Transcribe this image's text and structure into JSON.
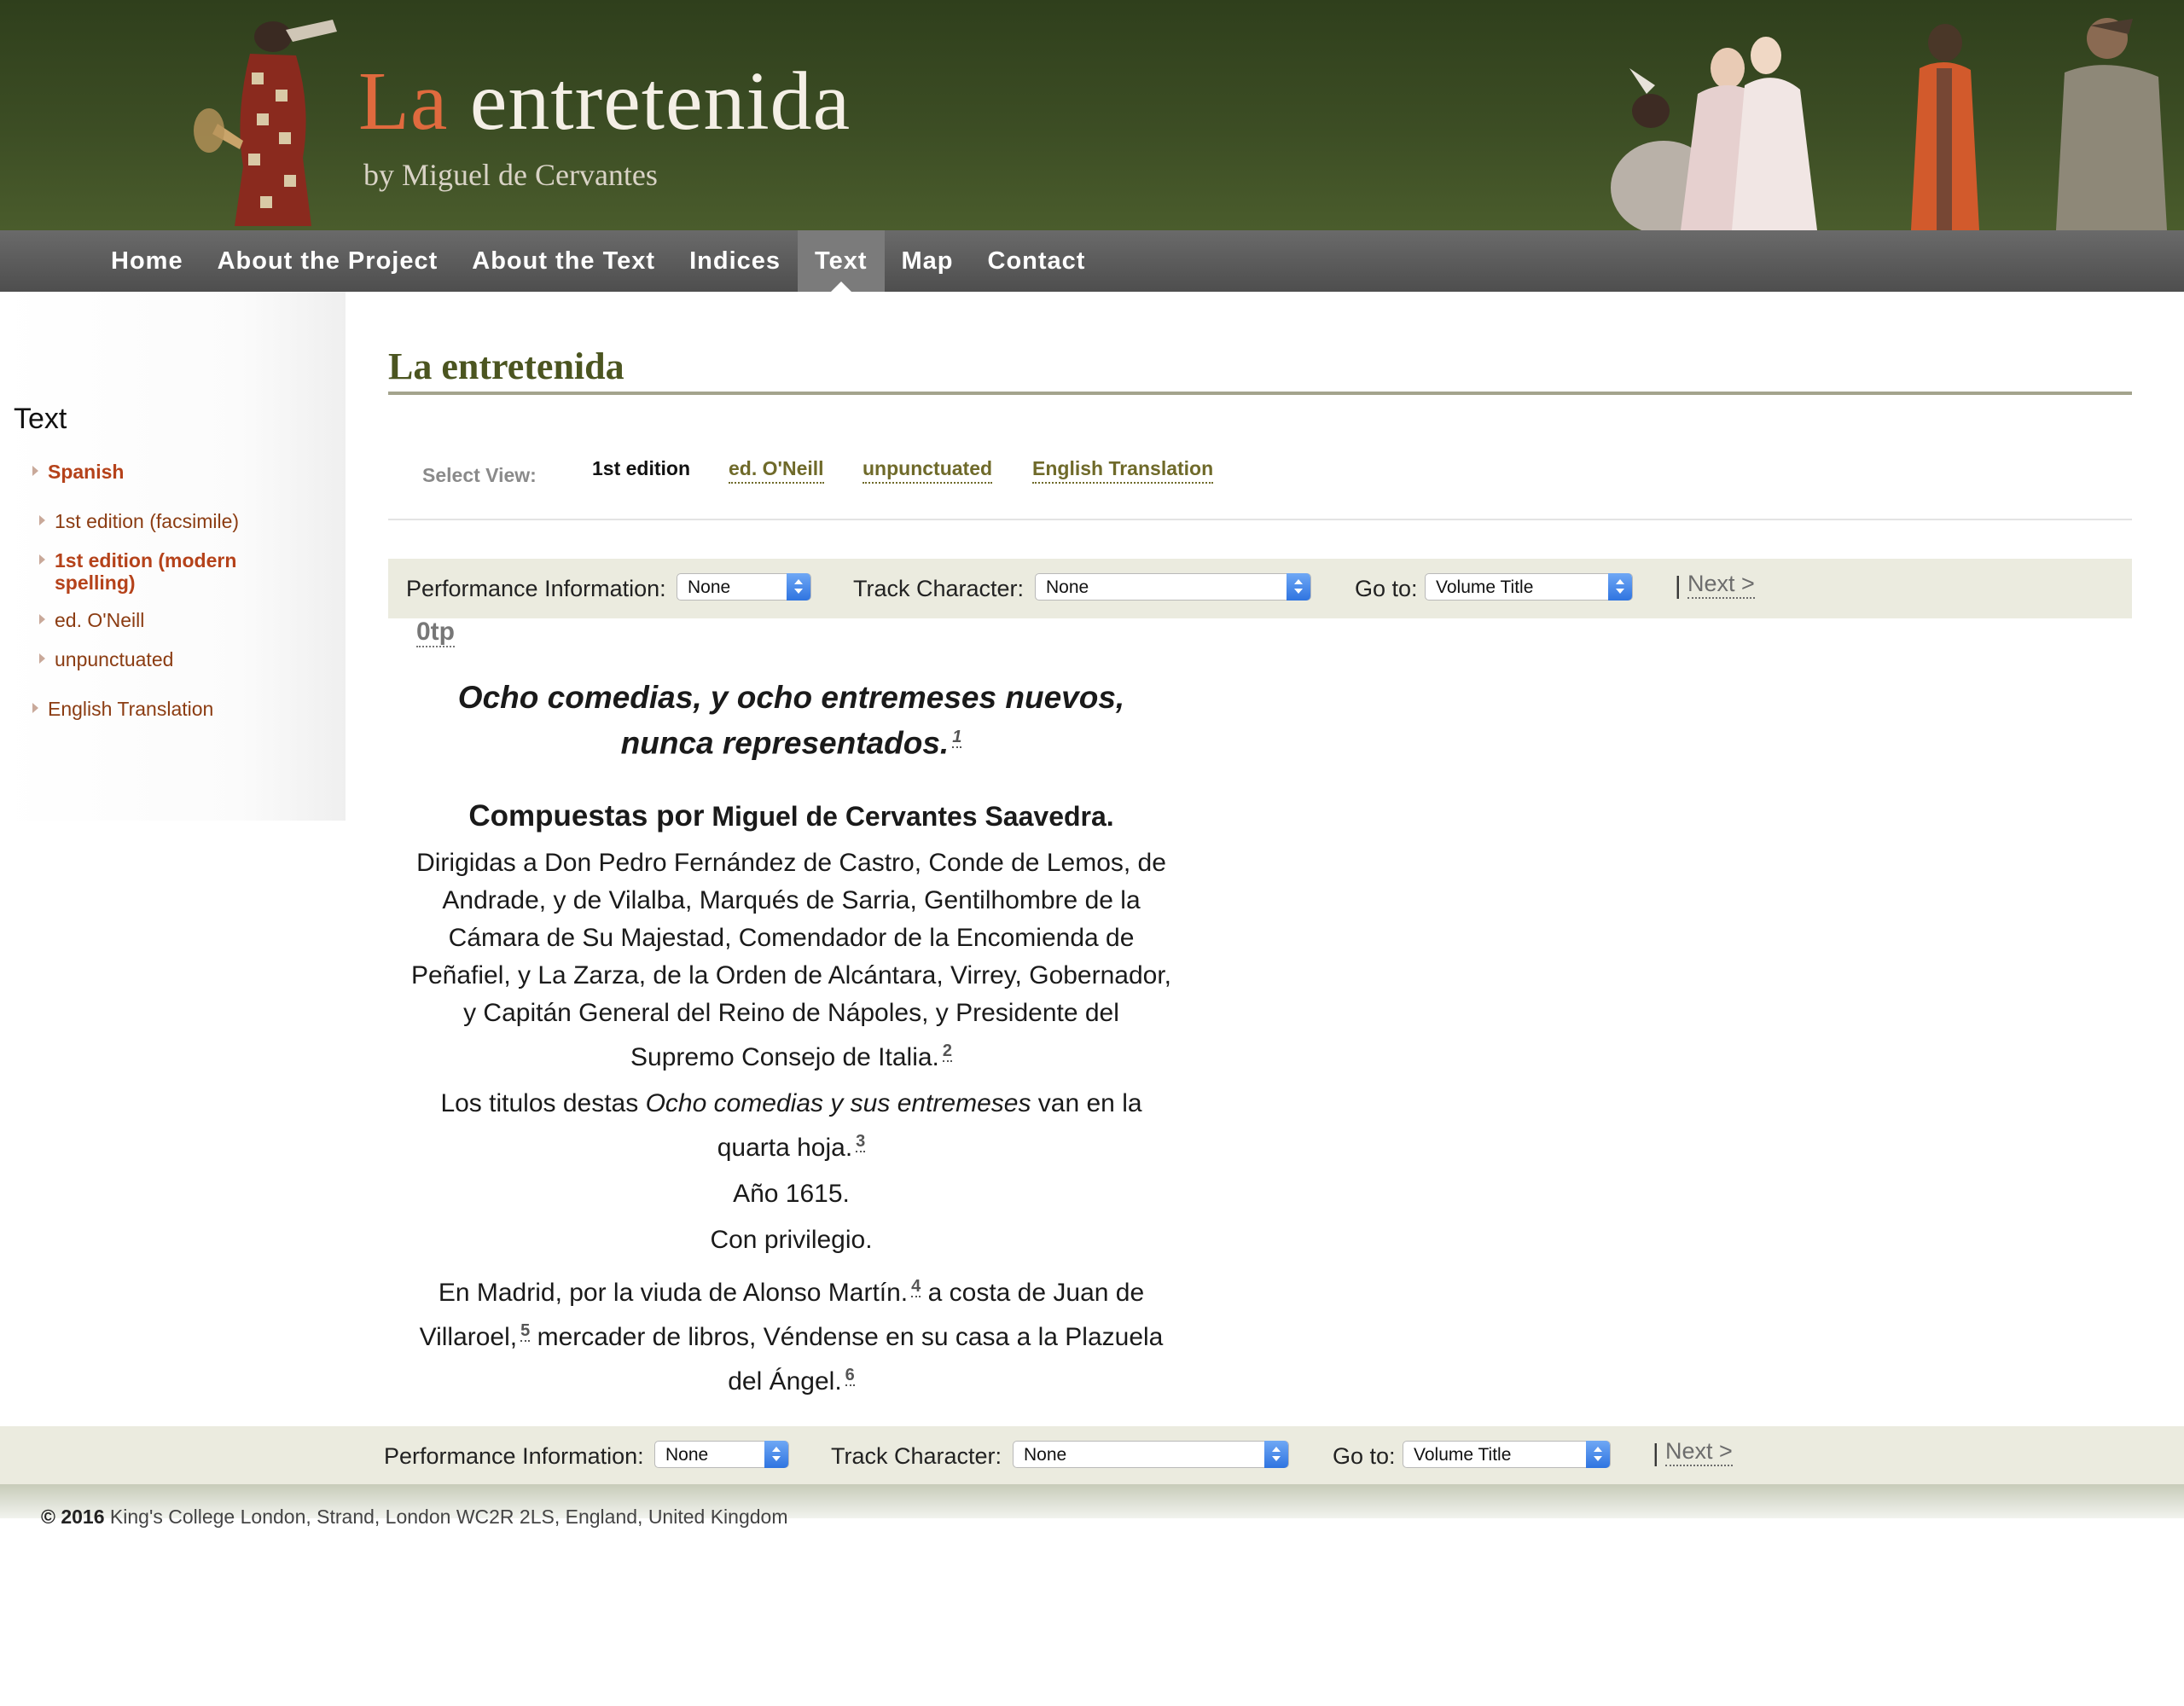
{
  "header": {
    "title_part1": "La",
    "title_part2": " entretenida",
    "subtitle": "by Miguel de Cervantes"
  },
  "nav": {
    "items": [
      {
        "label": "Home"
      },
      {
        "label": "About the Project"
      },
      {
        "label": "About the Text"
      },
      {
        "label": "Indices"
      },
      {
        "label": "Text",
        "active": true
      },
      {
        "label": "Map"
      },
      {
        "label": "Contact"
      }
    ]
  },
  "sidebar": {
    "heading": "Text",
    "items": [
      {
        "label": "Spanish"
      },
      {
        "label": "1st edition (facsimile)"
      },
      {
        "label": "1st edition (modern spelling)"
      },
      {
        "label": "ed. O'Neill"
      },
      {
        "label": "unpunctuated"
      },
      {
        "label": "English Translation"
      }
    ]
  },
  "main": {
    "title": "La entretenida",
    "select_view": {
      "label": "Select View:",
      "options": [
        "1st edition",
        "ed. O'Neill",
        "unpunctuated",
        "English Translation"
      ]
    },
    "toolbar": {
      "performance_label": "Performance Information:",
      "performance_value": "None",
      "track_label": "Track Character:",
      "track_value": "None",
      "goto_label": "Go to:",
      "goto_value": "Volume Title",
      "pipe": "|",
      "next": "Next >"
    },
    "page_id": "0tp",
    "text": {
      "title_line1": "Ocho comedias, y ocho entremeses nuevos,",
      "title_line2": "nunca representados.",
      "fn1": "1",
      "compuestas": "Compuestas por",
      "author": " Miguel de Cervantes Saavedra.",
      "dedication": "Dirigidas a Don Pedro Fernández de Castro, Conde de Lemos, de Andrade, y de Vilalba, Marqués de Sarria, Gentilhombre de la Cámara de Su Majestad, Comendador de la Encomienda de Peñafiel, y La Zarza, de la Orden de Alcántara, Virrey, Gobernador, y Capitán General del Reino de Nápoles, y Presidente del Supremo Consejo de Italia.",
      "fn2": "2",
      "titulos_pre": "Los titulos destas ",
      "titulos_it": "Ocho comedias y sus entremeses",
      "titulos_post": " van en la quarta hoja.",
      "fn3": "3",
      "year": "Año 1615.",
      "privilegio": "Con privilegio.",
      "madrid_a": "En Madrid, por la viuda de Alonso Martín.",
      "fn4": "4",
      "madrid_b": "a costa de Juan de Villaroel,",
      "fn5": "5",
      "madrid_c": "mercader de libros, Véndense en su casa a la Plazuela del Ángel.",
      "fn6": "6"
    }
  },
  "footer": {
    "copyright_bold": "© 2016",
    "copyright_text": " King's College London, Strand, London WC2R 2LS, England, United Kingdom"
  },
  "colors": {
    "banner_green": "#3c4d24",
    "title_accent": "#e06a3e",
    "nav_gray": "#5a5a5a",
    "link_brown": "#8b3c12",
    "heading_olive": "#4b5520",
    "toolbar_bg": "#ebebdf"
  }
}
